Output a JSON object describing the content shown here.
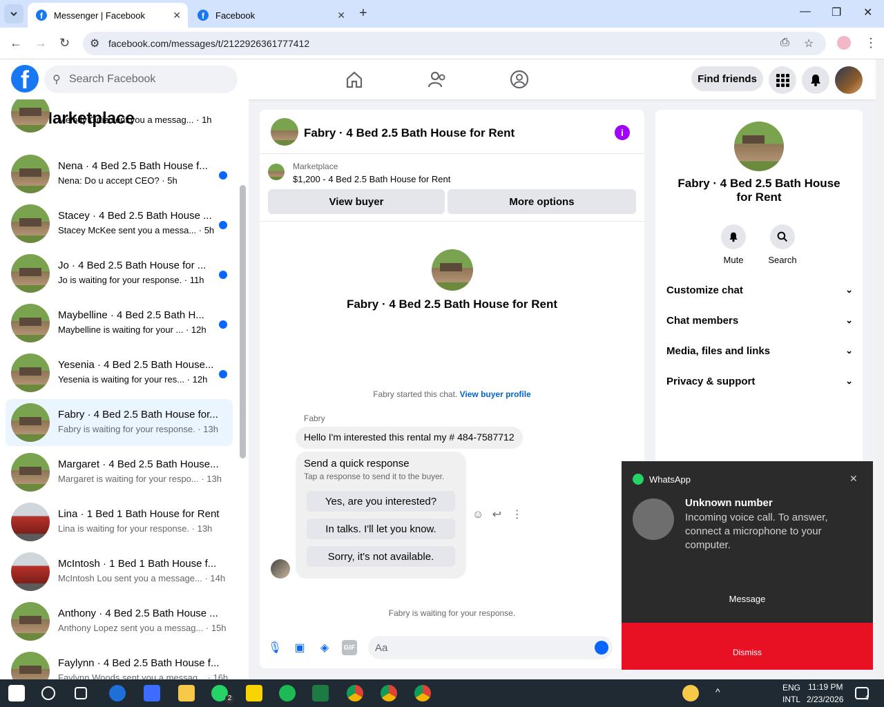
{
  "browser": {
    "tabs": [
      {
        "title": "Messenger | Facebook",
        "active": true
      },
      {
        "title": "Facebook",
        "active": false
      }
    ],
    "url": "facebook.com/messages/t/2122926361777412"
  },
  "header": {
    "search_placeholder": "Search Facebook",
    "find_friends": "Find friends"
  },
  "sidebar": {
    "title": "Marketplace",
    "partial_top": "Melody Ortiz sent you a messag... · 1h",
    "conversations": [
      {
        "name": "Nena · 4 Bed 2.5 Bath House f...",
        "sub": "Nena: Do u accept CEO? · 5h",
        "unread": true
      },
      {
        "name": "Stacey · 4 Bed 2.5 Bath House ...",
        "sub": "Stacey McKee sent you a messa... · 5h",
        "unread": true
      },
      {
        "name": "Jo · 4 Bed 2.5 Bath House for ...",
        "sub": "Jo is waiting for your response. · 11h",
        "unread": true
      },
      {
        "name": "Maybelline · 4 Bed 2.5 Bath H...",
        "sub": "Maybelline is waiting for your ... · 12h",
        "unread": true
      },
      {
        "name": "Yesenia · 4 Bed 2.5 Bath House...",
        "sub": "Yesenia is waiting for your res... · 12h",
        "unread": true
      },
      {
        "name": "Fabry · 4 Bed 2.5 Bath House for...",
        "sub": "Fabry is waiting for your response. · 13h",
        "unread": false
      },
      {
        "name": "Margaret · 4 Bed 2.5 Bath House...",
        "sub": "Margaret is waiting for your respo... · 13h",
        "unread": false
      },
      {
        "name": "Lina · 1 Bed 1 Bath House for Rent",
        "sub": "Lina is waiting for your response. · 13h",
        "unread": false
      },
      {
        "name": "McIntosh · 1 Bed 1 Bath House f...",
        "sub": "McIntosh Lou sent you a message... · 14h",
        "unread": false
      },
      {
        "name": "Anthony · 4 Bed 2.5 Bath House ...",
        "sub": "Anthony Lopez sent you a messag... · 15h",
        "unread": false
      },
      {
        "name": "Faylynn · 4 Bed 2.5 Bath House f...",
        "sub": "Faylynn Woods sent you a messag... · 16h",
        "unread": false
      }
    ]
  },
  "chat": {
    "title": "Fabry · 4 Bed 2.5 Bath House for Rent",
    "listing_source": "Marketplace",
    "listing_price": "$1,200 - 4 Bed 2.5 Bath House for Rent",
    "view_buyer": "View buyer",
    "more_options": "More options",
    "started_text": "Fabry started this chat.",
    "view_profile": "View buyer profile",
    "sender": "Fabry",
    "message": "Hello I'm interested this rental my # 484-7587712",
    "quick_title": "Send a quick response",
    "quick_sub": "Tap a response to send it to the buyer.",
    "quick_replies": [
      "Yes, are you interested?",
      "In talks. I'll let you know.",
      "Sorry, it's not available."
    ],
    "waiting": "Fabry is waiting for your response.",
    "composer_placeholder": "Aa"
  },
  "right_panel": {
    "title": "Fabry · 4 Bed 2.5 Bath House for Rent",
    "mute": "Mute",
    "search": "Search",
    "sections": [
      "Customize chat",
      "Chat members",
      "Media, files and links",
      "Privacy & support"
    ]
  },
  "toast": {
    "app": "WhatsApp",
    "title": "Unknown number",
    "body": "Incoming voice call. To answer, connect a microphone to your computer.",
    "message_btn": "Message",
    "dismiss_btn": "Dismiss"
  },
  "taskbar": {
    "lang1": "ENG",
    "lang2": "INTL",
    "time": "11:19 PM",
    "date": "2/23/2026",
    "whatsapp_badge": "2",
    "notif_badge": "4"
  }
}
